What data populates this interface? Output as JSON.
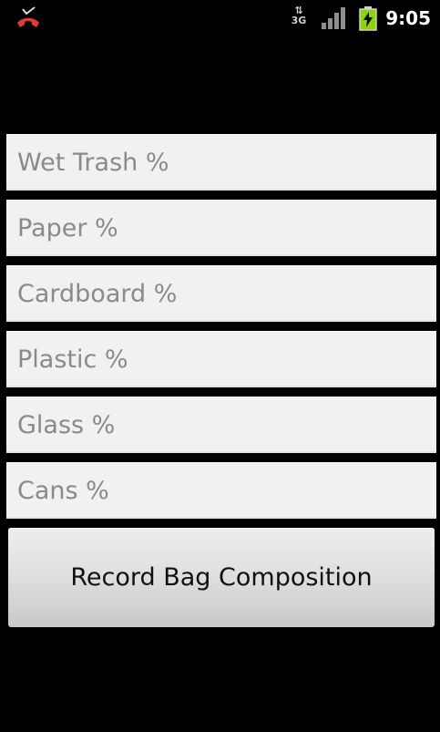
{
  "status_bar": {
    "time": "9:05",
    "network_type": "3G",
    "icons": [
      "missed-call-icon",
      "data-activity-icon",
      "signal-strength-icon",
      "battery-charging-icon"
    ]
  },
  "form": {
    "fields": [
      {
        "placeholder": "Wet Trash %",
        "value": ""
      },
      {
        "placeholder": "Paper %",
        "value": ""
      },
      {
        "placeholder": "Cardboard %",
        "value": ""
      },
      {
        "placeholder": "Plastic %",
        "value": ""
      },
      {
        "placeholder": "Glass %",
        "value": ""
      },
      {
        "placeholder": "Cans %",
        "value": ""
      }
    ],
    "submit_label": "Record Bag Composition"
  },
  "colors": {
    "background": "#000000",
    "field_background": "#f1f1f1",
    "placeholder_text": "#8a8a8a",
    "battery_green": "#8fd400",
    "missed_call_red": "#e53a2a"
  }
}
